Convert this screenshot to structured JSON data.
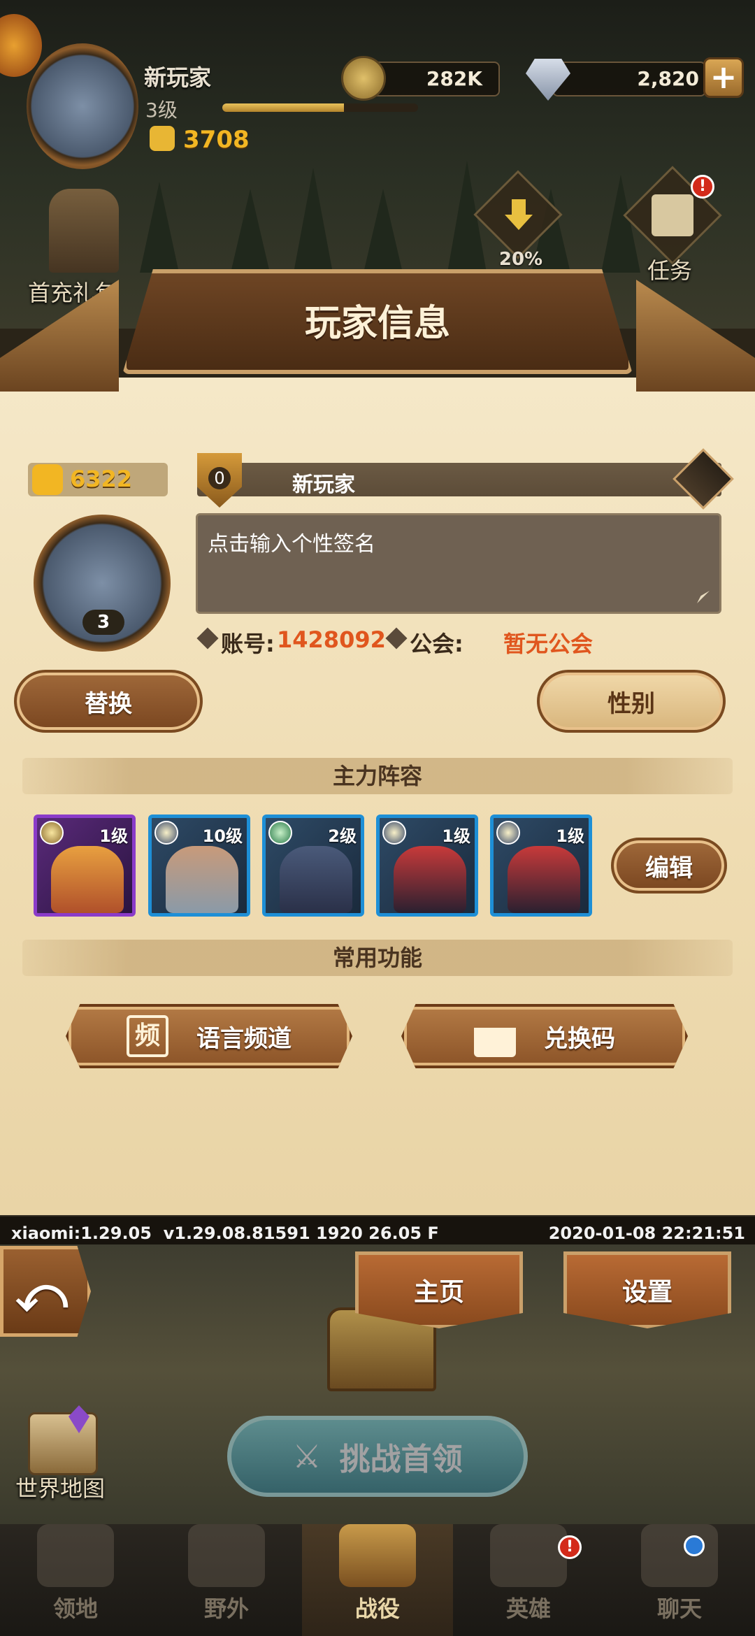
{
  "header": {
    "player_name": "新玩家",
    "level": "3级",
    "power": "3708",
    "gold": "282K",
    "diamonds": "2,820",
    "level_progress": 0.62,
    "add_button": "+"
  },
  "side": {
    "first_recharge": "首充礼包",
    "task": "任务",
    "percent": "20%",
    "task_badge": "!"
  },
  "panel": {
    "title": "玩家信息",
    "power": "6322",
    "rank": "0",
    "name": "新玩家",
    "signature_placeholder": "点击输入个性签名",
    "avatar_level": "3",
    "account_label": "账号:",
    "account_id": "1428092",
    "guild_label": "公会:",
    "guild_value": "暂无公会",
    "replace_button": "替换",
    "gender_button": "性别",
    "lineup_title": "主力阵容",
    "heroes": [
      {
        "level": "1级",
        "frame": "purple"
      },
      {
        "level": "10级",
        "frame": "blue"
      },
      {
        "level": "2级",
        "frame": "blue"
      },
      {
        "level": "1级",
        "frame": "blue"
      },
      {
        "level": "1级",
        "frame": "blue"
      }
    ],
    "edit_button": "编辑",
    "functions_title": "常用功能",
    "language_channel": "语言频道",
    "language_icon": "频",
    "redeem_code": "兑换码"
  },
  "status": {
    "left": "xiaomi:1.29.05  v1.29.08.81591 1920 26.05 F",
    "right": "2020-01-08 22:21:51"
  },
  "scene": {
    "home": "主页",
    "settings": "设置",
    "world_map": "世界地图",
    "challenge": "挑战首领"
  },
  "nav": {
    "items": [
      "领地",
      "野外",
      "战役",
      "英雄",
      "聊天"
    ],
    "active": "战役",
    "hero_badge": "!"
  }
}
